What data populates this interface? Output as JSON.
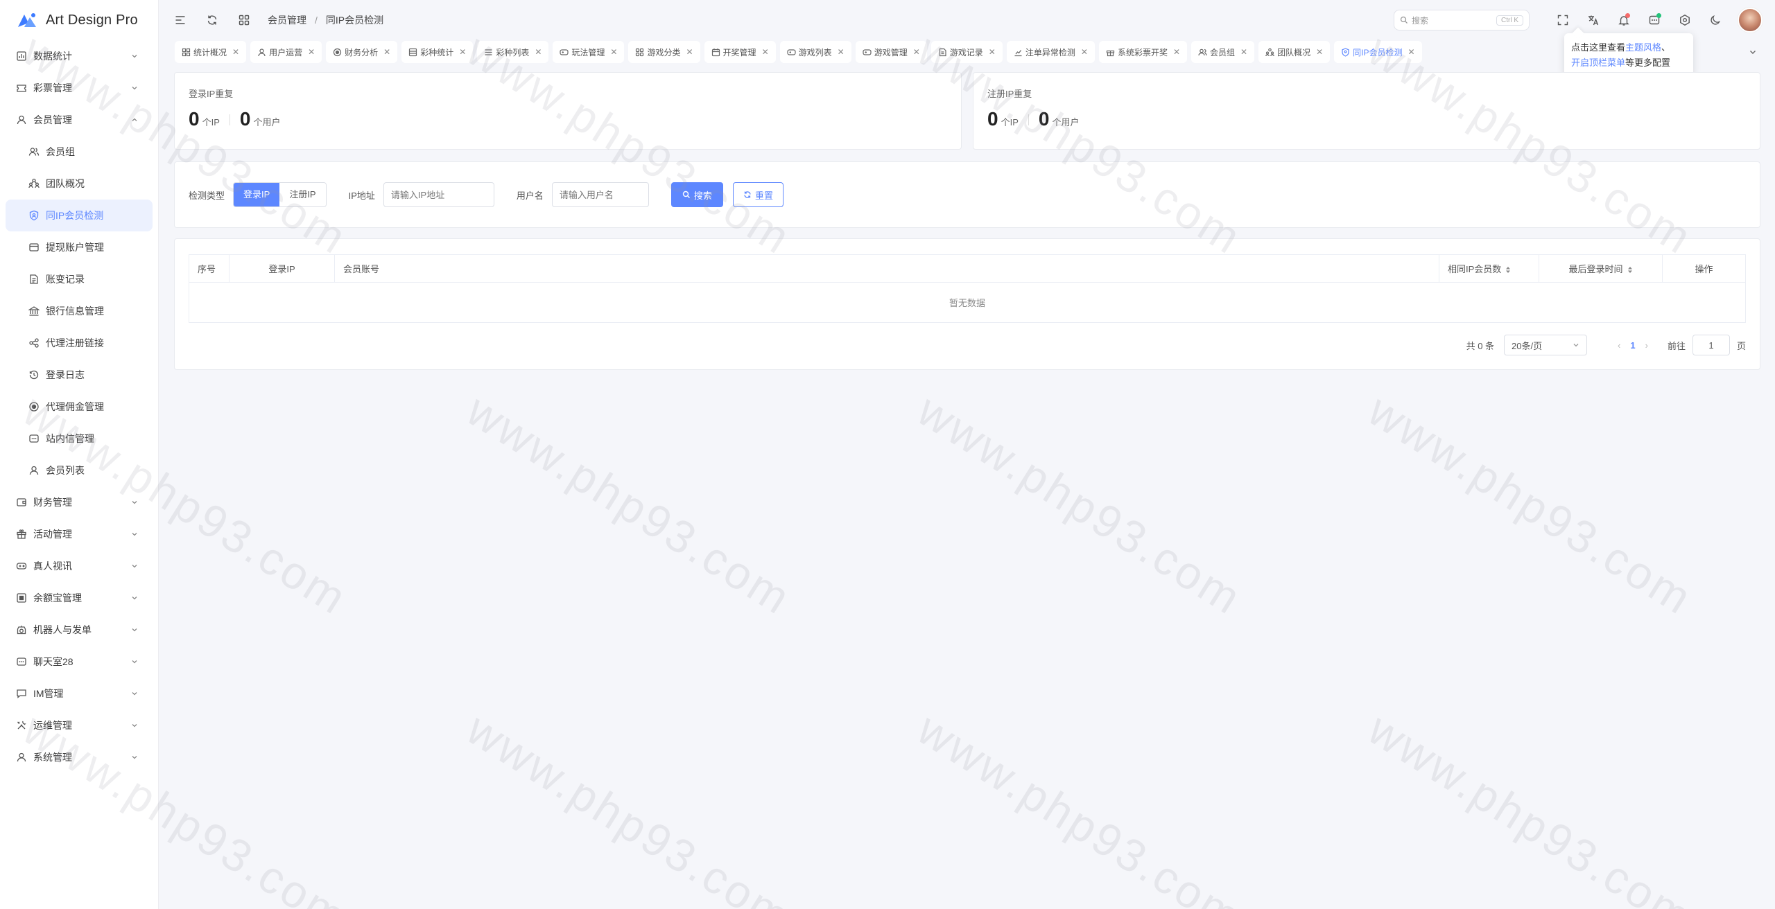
{
  "app": {
    "name": "Art Design Pro"
  },
  "sidebar": {
    "items": [
      {
        "label": "数据统计",
        "icon": "bar-chart-icon"
      },
      {
        "label": "彩票管理",
        "icon": "ticket-icon"
      },
      {
        "label": "会员管理",
        "icon": "user-icon",
        "expanded": true,
        "children": [
          {
            "label": "会员组",
            "icon": "users-icon"
          },
          {
            "label": "团队概况",
            "icon": "team-icon"
          },
          {
            "label": "同IP会员检测",
            "icon": "shield-icon",
            "active": true
          },
          {
            "label": "提现账户管理",
            "icon": "card-icon"
          },
          {
            "label": "账变记录",
            "icon": "document-icon"
          },
          {
            "label": "银行信息管理",
            "icon": "bank-icon"
          },
          {
            "label": "代理注册链接",
            "icon": "share-icon"
          },
          {
            "label": "登录日志",
            "icon": "history-icon"
          },
          {
            "label": "代理佣金管理",
            "icon": "coin-icon"
          },
          {
            "label": "站内信管理",
            "icon": "message-icon"
          },
          {
            "label": "会员列表",
            "icon": "user-icon"
          }
        ]
      },
      {
        "label": "财务管理",
        "icon": "wallet-icon"
      },
      {
        "label": "活动管理",
        "icon": "gift-icon"
      },
      {
        "label": "真人视讯",
        "icon": "gamepad-icon"
      },
      {
        "label": "余额宝管理",
        "icon": "safe-icon"
      },
      {
        "label": "机器人与发单",
        "icon": "robot-icon"
      },
      {
        "label": "聊天室28",
        "icon": "chat-box-icon"
      },
      {
        "label": "IM管理",
        "icon": "chat-icon"
      },
      {
        "label": "运维管理",
        "icon": "tools-icon"
      },
      {
        "label": "系统管理",
        "icon": "user-icon"
      }
    ]
  },
  "header": {
    "breadcrumb": [
      "会员管理",
      "同IP会员检测"
    ],
    "search_placeholder": "搜索",
    "search_shortcut": "Ctrl K"
  },
  "tabs": [
    {
      "label": "统计概况",
      "icon": "grid-icon"
    },
    {
      "label": "用户运营",
      "icon": "user-icon"
    },
    {
      "label": "财务分析",
      "icon": "coin-icon"
    },
    {
      "label": "彩种统计",
      "icon": "list-icon"
    },
    {
      "label": "彩种列表",
      "icon": "list-icon"
    },
    {
      "label": "玩法管理",
      "icon": "gamepad-icon"
    },
    {
      "label": "游戏分类",
      "icon": "grid-icon"
    },
    {
      "label": "开奖管理",
      "icon": "calendar-icon"
    },
    {
      "label": "游戏列表",
      "icon": "gamepad-icon"
    },
    {
      "label": "游戏管理",
      "icon": "gamepad-icon"
    },
    {
      "label": "游戏记录",
      "icon": "document-icon"
    },
    {
      "label": "注单异常检测",
      "icon": "chart-icon"
    },
    {
      "label": "系统彩票开奖",
      "icon": "gift-icon"
    },
    {
      "label": "会员组",
      "icon": "users-icon"
    },
    {
      "label": "团队概况",
      "icon": "team-icon"
    },
    {
      "label": "同IP会员检测",
      "icon": "shield-icon",
      "active": true
    }
  ],
  "tooltip": {
    "line1_prefix": "点击这里查看",
    "line1_link": "主题风格",
    "line1_suffix": "、",
    "line2_link": "开启顶栏菜单",
    "line2_suffix": "等更多配置"
  },
  "stats": {
    "login": {
      "title": "登录IP重复",
      "ip_count": "0",
      "ip_unit": "个IP",
      "user_count": "0",
      "user_unit": "个用户"
    },
    "register": {
      "title": "注册IP重复",
      "ip_count": "0",
      "ip_unit": "个IP",
      "user_count": "0",
      "user_unit": "个用户"
    }
  },
  "filter": {
    "type_label": "检测类型",
    "types": [
      "登录IP",
      "注册IP"
    ],
    "selected_type": "登录IP",
    "ip_label": "IP地址",
    "ip_placeholder": "请输入IP地址",
    "ip_value": "",
    "user_label": "用户名",
    "user_placeholder": "请输入用户名",
    "user_value": "",
    "search_label": "搜索",
    "reset_label": "重置"
  },
  "table": {
    "columns": [
      "序号",
      "登录IP",
      "会员账号",
      "相同IP会员数",
      "最后登录时间",
      "操作"
    ],
    "rows": [],
    "empty_text": "暂无数据"
  },
  "pager": {
    "total_text": "共 0 条",
    "page_size": "20条/页",
    "current_page": "1",
    "goto_label": "前往",
    "goto_value": "1",
    "page_suffix": "页"
  },
  "watermark": "www.php93.com",
  "colors": {
    "accent": "#5d87ff",
    "background": "#f5f6fa"
  }
}
